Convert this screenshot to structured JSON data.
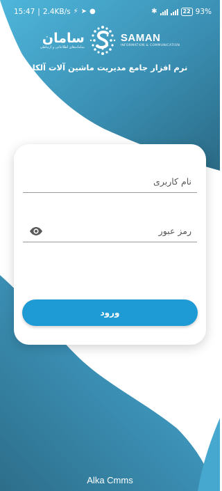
{
  "status_bar": {
    "time": "15:47",
    "net_speed": "2.4KB/s",
    "battery_level": "22",
    "battery_percent": "93%",
    "left_icons": [
      "data-saver-icon",
      "paper-plane-icon",
      "notification-icon"
    ],
    "right_icons": [
      "bluetooth-icon",
      "signal-icon",
      "signal-4g-icon",
      "battery-icon"
    ]
  },
  "logo": {
    "name_fa": "سامان",
    "tagline_fa": "سامانه‌های اطلاعاتی و ارتباطی",
    "name_en": "SAMAN",
    "tagline_en": "INFORMATION & COMMUNICATION"
  },
  "header": {
    "subtitle": "نرم افزار جامع مدیریت ماشین آلات آلکا"
  },
  "form": {
    "username_placeholder": "نام کاربری",
    "username_value": "",
    "password_placeholder": "رمز عبور",
    "password_value": "",
    "login_label": "ورود"
  },
  "footer": {
    "app_name": "Alka Cmms"
  },
  "colors": {
    "gradient_light": "#4fb2d6",
    "gradient_dark": "#2b6a85",
    "primary_button": "#1e9bd4",
    "card": "#ffffff"
  }
}
